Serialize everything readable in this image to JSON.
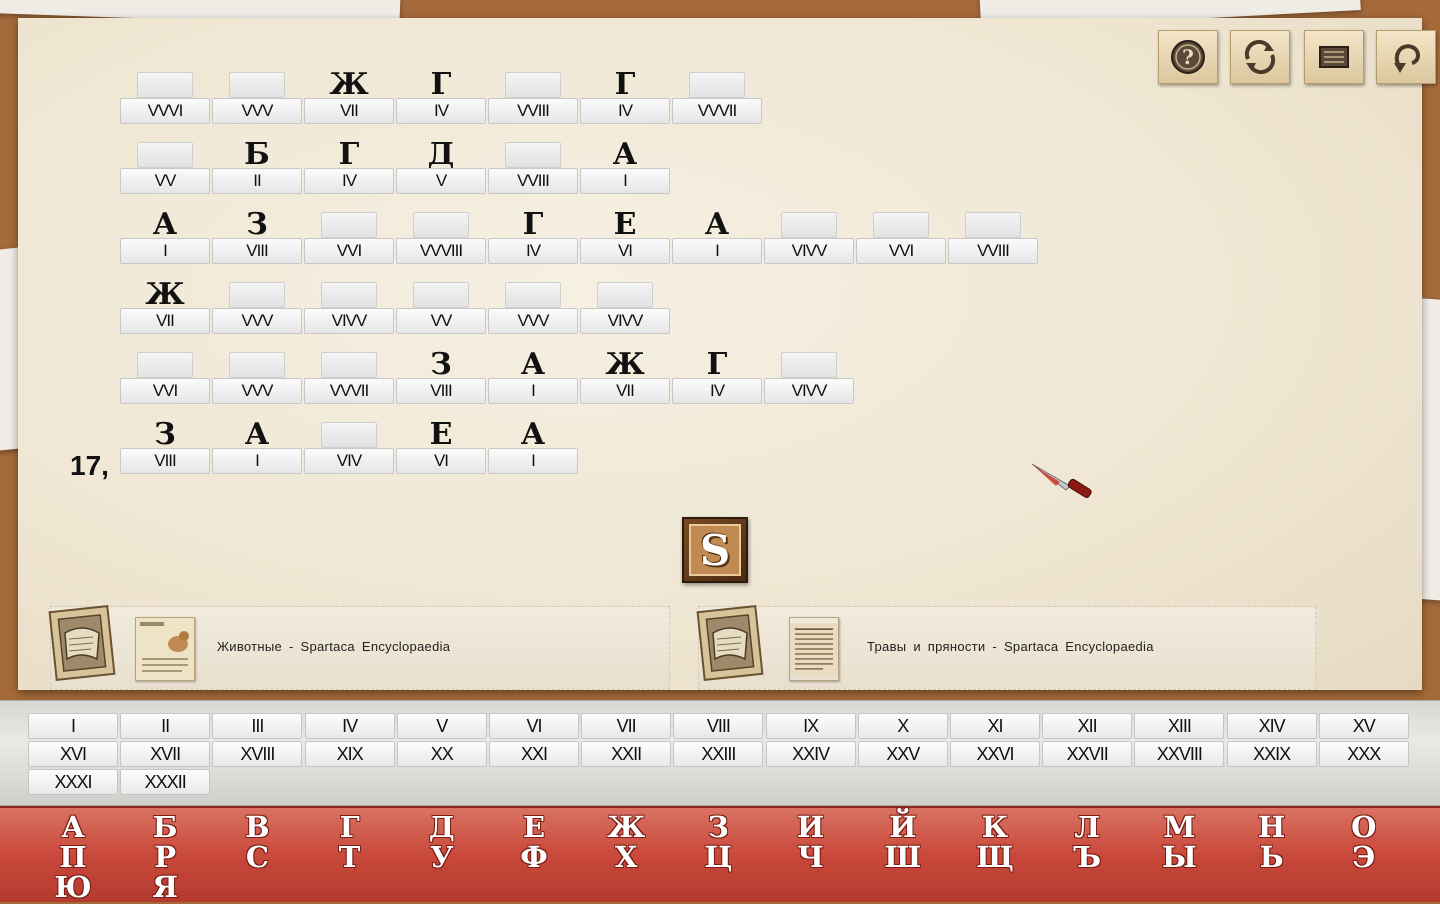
{
  "toolbar": [
    {
      "name": "help-button",
      "icon": "question-icon"
    },
    {
      "name": "restart-button",
      "icon": "refresh-icon"
    },
    {
      "name": "menu-button",
      "icon": "menu-icon"
    },
    {
      "name": "back-button",
      "icon": "undo-icon"
    }
  ],
  "rows": [
    {
      "cells": [
        {
          "letter": "",
          "num": "VVVI"
        },
        {
          "letter": "",
          "num": "VVV"
        },
        {
          "letter": "Ж",
          "num": "VII"
        },
        {
          "letter": "Г",
          "num": "IV"
        },
        {
          "letter": "",
          "num": "VVIII"
        },
        {
          "letter": "Г",
          "num": "IV"
        },
        {
          "letter": "",
          "num": "VVVII"
        }
      ]
    },
    {
      "cells": [
        {
          "letter": "",
          "num": "VV"
        },
        {
          "letter": "Б",
          "num": "II"
        },
        {
          "letter": "Г",
          "num": "IV"
        },
        {
          "letter": "Д",
          "num": "V"
        },
        {
          "letter": "",
          "num": "VVIII"
        },
        {
          "letter": "А",
          "num": "I"
        }
      ]
    },
    {
      "cells": [
        {
          "letter": "А",
          "num": "I"
        },
        {
          "letter": "З",
          "num": "VIII"
        },
        {
          "letter": "",
          "num": "VVI"
        },
        {
          "letter": "",
          "num": "VVVIII"
        },
        {
          "letter": "Г",
          "num": "IV"
        },
        {
          "letter": "Е",
          "num": "VI"
        },
        {
          "letter": "А",
          "num": "I"
        },
        {
          "letter": "",
          "num": "VIVV"
        },
        {
          "letter": "",
          "num": "VVI"
        },
        {
          "letter": "",
          "num": "VVIII"
        }
      ]
    },
    {
      "cells": [
        {
          "letter": "Ж",
          "num": "VII"
        },
        {
          "letter": "",
          "num": "VVV"
        },
        {
          "letter": "",
          "num": "VIVV"
        },
        {
          "letter": "",
          "num": "VV"
        },
        {
          "letter": "",
          "num": "VVV"
        },
        {
          "letter": "",
          "num": "VIVV"
        }
      ]
    },
    {
      "cells": [
        {
          "letter": "",
          "num": "VVI"
        },
        {
          "letter": "",
          "num": "VVV"
        },
        {
          "letter": "",
          "num": "VVVII"
        },
        {
          "letter": "З",
          "num": "VIII"
        },
        {
          "letter": "А",
          "num": "I"
        },
        {
          "letter": "Ж",
          "num": "VII"
        },
        {
          "letter": "Г",
          "num": "IV"
        },
        {
          "letter": "",
          "num": "VIVV"
        }
      ]
    },
    {
      "label": "17,",
      "cells": [
        {
          "letter": "З",
          "num": "VIII"
        },
        {
          "letter": "А",
          "num": "I"
        },
        {
          "letter": "",
          "num": "VIV"
        },
        {
          "letter": "Е",
          "num": "VI"
        },
        {
          "letter": "А",
          "num": "I"
        }
      ]
    }
  ],
  "hint_button": {
    "label": "S"
  },
  "links": [
    {
      "text": "Животные - Spartaca Encyclopaedia"
    },
    {
      "text": "Травы и пряности - Spartaca Encyclopaedia"
    }
  ],
  "numerals": [
    "I",
    "II",
    "III",
    "IV",
    "V",
    "VI",
    "VII",
    "VIII",
    "IX",
    "X",
    "XI",
    "XII",
    "XIII",
    "XIV",
    "XV",
    "XVI",
    "XVII",
    "XVIII",
    "XIX",
    "XX",
    "XXI",
    "XXII",
    "XXIII",
    "XXIV",
    "XXV",
    "XXVI",
    "XXVII",
    "XXVIII",
    "XXIX",
    "XXX",
    "XXXI",
    "XXXII"
  ],
  "alphabet": [
    "А",
    "Б",
    "В",
    "Г",
    "Д",
    "Е",
    "Ж",
    "З",
    "И",
    "Й",
    "К",
    "Л",
    "М",
    "Н",
    "О",
    "П",
    "Р",
    "С",
    "Т",
    "У",
    "Ф",
    "Х",
    "Ц",
    "Ч",
    "Ш",
    "Щ",
    "Ъ",
    "Ы",
    "Ь",
    "Э",
    "Ю",
    "Я"
  ]
}
